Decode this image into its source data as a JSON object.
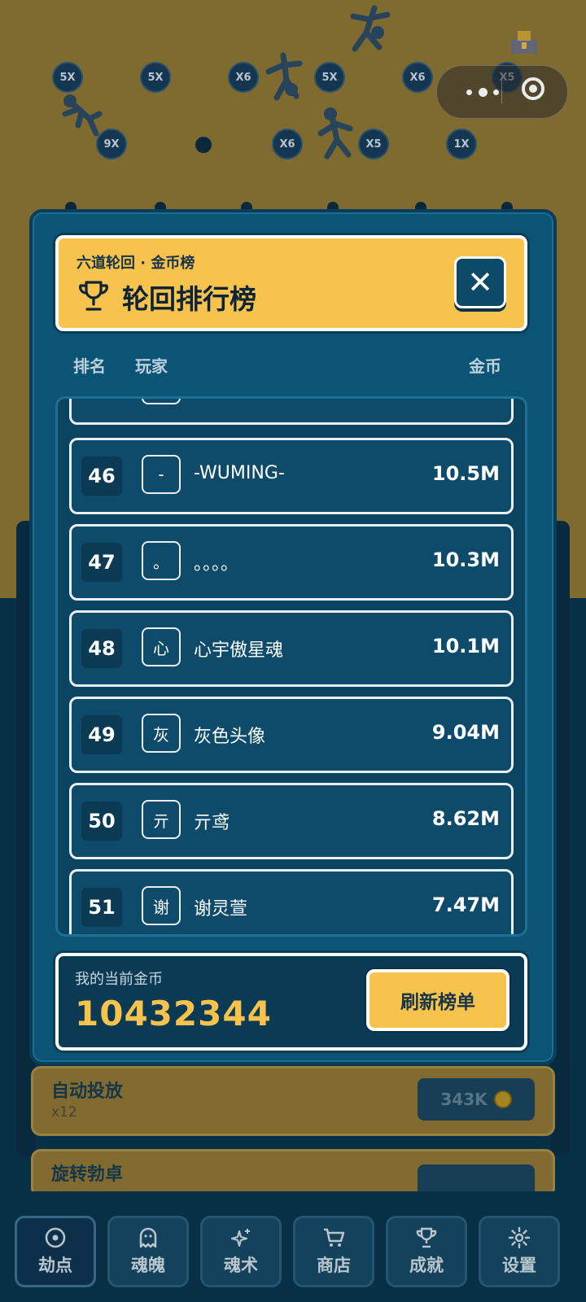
{
  "game": {
    "multipliers": [
      "5X",
      "5X",
      "X6",
      "5X",
      "X6",
      "X5",
      "9X",
      "X6",
      "X5",
      "1X"
    ]
  },
  "underlay": {
    "auto_drop": {
      "title": "自动投放",
      "sub": "x12",
      "price": "343K"
    },
    "rotate": {
      "title": "旋转勃卓"
    }
  },
  "tabs": [
    {
      "label": "劫点",
      "icon": "target-icon"
    },
    {
      "label": "魂魄",
      "icon": "ghost-icon"
    },
    {
      "label": "魂术",
      "icon": "sparkle-icon"
    },
    {
      "label": "商店",
      "icon": "cart-icon"
    },
    {
      "label": "成就",
      "icon": "trophy-icon"
    },
    {
      "label": "设置",
      "icon": "gear-icon"
    }
  ],
  "modal": {
    "kicker": "六道轮回 · 金币榜",
    "title": "轮回排行榜",
    "columns": {
      "rank": "排名",
      "player": "玩家",
      "coins": "金币"
    },
    "rows": [
      {
        "rank": "46",
        "avatar": "-",
        "name": "-WUMING-",
        "coins": "10.5M"
      },
      {
        "rank": "47",
        "avatar": "。",
        "name": "。。。。",
        "coins": "10.3M"
      },
      {
        "rank": "48",
        "avatar": "心",
        "name": "心宇傲星魂",
        "coins": "10.1M"
      },
      {
        "rank": "49",
        "avatar": "灰",
        "name": "灰色头像",
        "coins": "9.04M"
      },
      {
        "rank": "50",
        "avatar": "亓",
        "name": "亓鸢",
        "coins": "8.62M"
      },
      {
        "rank": "51",
        "avatar": "谢",
        "name": "谢灵萱",
        "coins": "7.47M"
      }
    ],
    "footer": {
      "label": "我的当前金币",
      "value": "10432344",
      "refresh": "刷新榜单"
    }
  },
  "colors": {
    "accent": "#f7c34d",
    "panel": "#0c5476",
    "dark": "#0a3a54"
  }
}
